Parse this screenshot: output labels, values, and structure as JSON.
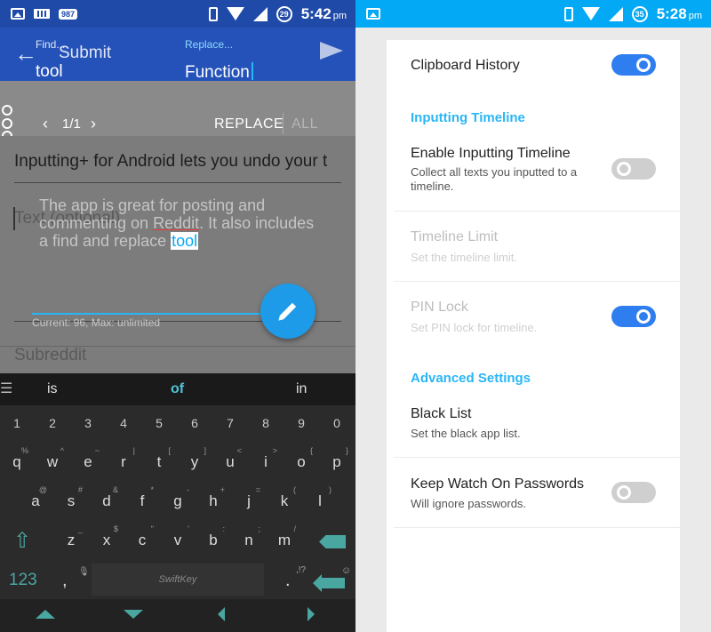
{
  "left": {
    "status": {
      "time": "5:42",
      "ampm": "pm",
      "notif_badge": "987",
      "battery": "29"
    },
    "find": {
      "label": "Find...",
      "submit_label": "Submit",
      "value": "tool"
    },
    "replace": {
      "label": "Replace...",
      "value": "Function"
    },
    "nav": {
      "count": "1/1",
      "replace_label": "REPLACE",
      "all_label": "ALL"
    },
    "post": {
      "title": "Inputting+ for Android lets you undo your t",
      "text_placeholder": "Text (optional)",
      "body_1": "The app is great for posting and commenting on ",
      "body_link": "Reddit",
      "body_2": ". It also includes a find and replace ",
      "body_highlight": "tool",
      "counter": "Current: 96, Max: unlimited",
      "subreddit_placeholder": "Subreddit"
    },
    "keyboard": {
      "suggestions": [
        "is",
        "of",
        "in"
      ],
      "numbers": [
        "1",
        "2",
        "3",
        "4",
        "5",
        "6",
        "7",
        "8",
        "9",
        "0"
      ],
      "row1": [
        {
          "k": "q",
          "a": "%"
        },
        {
          "k": "w",
          "a": "^"
        },
        {
          "k": "e",
          "a": "~"
        },
        {
          "k": "r",
          "a": "|"
        },
        {
          "k": "t",
          "a": "["
        },
        {
          "k": "y",
          "a": "]"
        },
        {
          "k": "u",
          "a": "<"
        },
        {
          "k": "i",
          "a": ">"
        },
        {
          "k": "o",
          "a": "{"
        },
        {
          "k": "p",
          "a": "}"
        }
      ],
      "row2": [
        {
          "k": "a",
          "a": "@"
        },
        {
          "k": "s",
          "a": "#"
        },
        {
          "k": "d",
          "a": "&"
        },
        {
          "k": "f",
          "a": "*"
        },
        {
          "k": "g",
          "a": "-"
        },
        {
          "k": "h",
          "a": "+"
        },
        {
          "k": "j",
          "a": "="
        },
        {
          "k": "k",
          "a": "("
        },
        {
          "k": "l",
          "a": ")"
        }
      ],
      "row3": [
        {
          "k": "z",
          "a": "_"
        },
        {
          "k": "x",
          "a": "$"
        },
        {
          "k": "c",
          "a": "\""
        },
        {
          "k": "v",
          "a": "'"
        },
        {
          "k": "b",
          "a": ":"
        },
        {
          "k": "n",
          "a": ";"
        },
        {
          "k": "m",
          "a": "/"
        }
      ],
      "key_123": "123",
      "comma": ",",
      "period": ".",
      "punct_alt": ",!?",
      "space_brand": "SwiftKey",
      "accent_color": "#4aa6a0"
    }
  },
  "right": {
    "status": {
      "time": "5:28",
      "ampm": "pm",
      "battery": "35"
    },
    "clipboard": {
      "title": "Clipboard History",
      "on": true
    },
    "section_timeline": "Inputting Timeline",
    "enable_timeline": {
      "title": "Enable Inputting Timeline",
      "sub": "Collect all texts you inputted to a timeline.",
      "on": false
    },
    "timeline_limit": {
      "title": "Timeline Limit",
      "sub": "Set the timeline limit."
    },
    "pin_lock": {
      "title": "PIN Lock",
      "sub": "Set PIN lock for timeline.",
      "on": true
    },
    "section_advanced": "Advanced Settings",
    "black_list": {
      "title": "Black List",
      "sub": "Set the black app list."
    },
    "keep_watch": {
      "title": "Keep Watch On Passwords",
      "sub": "Will ignore passwords.",
      "on": false
    },
    "accent_color": "#29b6f6",
    "toggle_on_color": "#2e7ef0"
  }
}
